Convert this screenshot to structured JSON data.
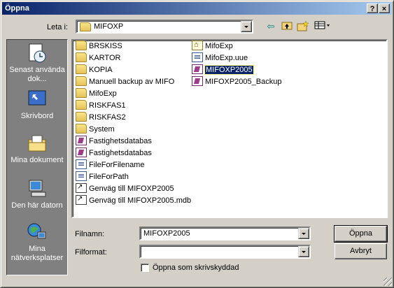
{
  "window": {
    "title": "Öppna",
    "help_label": "?",
    "close_label": "×"
  },
  "toolbar": {
    "look_in_label": "Leta i:",
    "look_in_value": "MIFOXP"
  },
  "places": [
    {
      "label": "Senast använda dok...",
      "icon": "recent-docs-icon"
    },
    {
      "label": "Skrivbord",
      "icon": "desktop-icon"
    },
    {
      "label": "Mina dokument",
      "icon": "my-documents-icon"
    },
    {
      "label": "Den här datorn",
      "icon": "my-computer-icon"
    },
    {
      "label": "Mina nätverksplatser",
      "icon": "network-places-icon"
    }
  ],
  "files_col1": [
    {
      "name": "BRSKISS",
      "type": "folder"
    },
    {
      "name": "KARTOR",
      "type": "folder"
    },
    {
      "name": "KOPIA",
      "type": "folder"
    },
    {
      "name": "Manuell backup av MIFO",
      "type": "folder"
    },
    {
      "name": "MifoExp",
      "type": "folder"
    },
    {
      "name": "RISKFAS1",
      "type": "folder"
    },
    {
      "name": "RISKFAS2",
      "type": "folder"
    },
    {
      "name": "System",
      "type": "folder"
    },
    {
      "name": "Fastighetsdatabas",
      "type": "accdb"
    },
    {
      "name": "Fastighetsdatabas",
      "type": "accdb"
    },
    {
      "name": "FileForFilename",
      "type": "doc"
    },
    {
      "name": "FileForPath",
      "type": "doc"
    },
    {
      "name": "Genväg till MIFOXP2005",
      "type": "shortcut"
    },
    {
      "name": "Genväg till MIFOXP2005.mdb",
      "type": "shortcut"
    }
  ],
  "files_col2": [
    {
      "name": "MifoExp",
      "type": "exe"
    },
    {
      "name": "MifoExp.uue",
      "type": "doc"
    },
    {
      "name": "MIFOXP2005",
      "type": "accdb",
      "selected": true
    },
    {
      "name": "MIFOXP2005_Backup",
      "type": "accdb"
    }
  ],
  "filename": {
    "label": "Filnamn:",
    "value": "MIFOXP2005"
  },
  "filetype": {
    "label": "Filformat:",
    "value": ""
  },
  "readonly": {
    "label": "Öppna som skrivskyddad",
    "checked": false
  },
  "buttons": {
    "open": "Öppna",
    "cancel": "Avbryt"
  }
}
